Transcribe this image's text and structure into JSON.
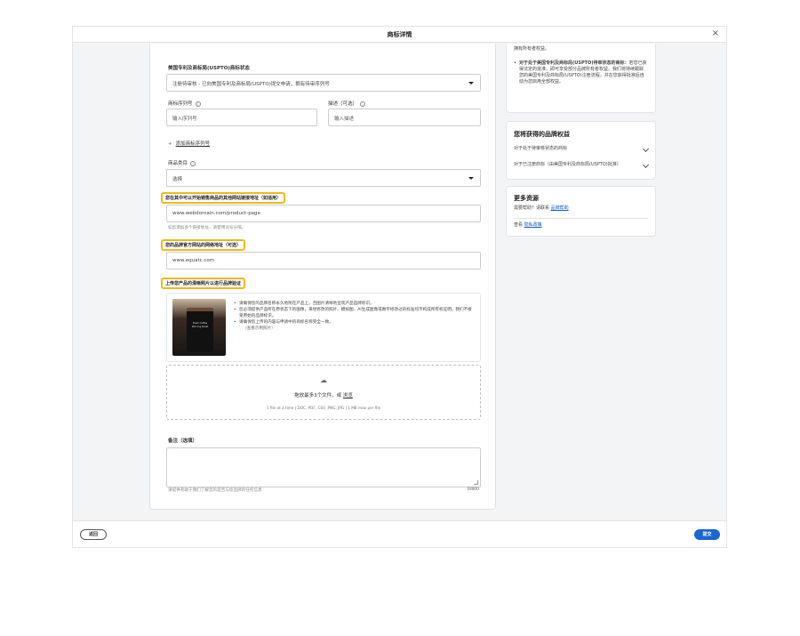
{
  "window": {
    "title": "商标详情",
    "close_glyph": "×"
  },
  "form": {
    "uspto_status_label": "美国专利及商标局(USPTO)商标状态",
    "uspto_status_value": "注册待审核 - 已向美国专利及商标局(USPTO)提交申请，拥有待审序列号",
    "serial_label": "商标序列号",
    "serial_placeholder": "输入序列号",
    "desc_label": "描述（可选）",
    "desc_placeholder": "输入描述",
    "add_serial_plus": "+",
    "add_serial_link": "添加商标序列号",
    "category_label": "商品类目",
    "category_value": "选择",
    "other_sites_label": "您在其中可以开始销售商品的其他网站链接地址（如适用）",
    "other_sites_value": "www.webdomain.com/product-page",
    "other_sites_hint": "如您添加多个链接地址，请使用逗号分隔。",
    "official_site_label": "您的品牌官方网站的网络地址（可选）",
    "official_site_value": "www.equatc.com",
    "upload_label": "上传您产品的清晰照片以进行品牌验证",
    "image_text": "Fresh Coffee Morning Roast",
    "guidelines": [
      "请确保您的品牌名称永久地附在产品上，且图片清晰地呈现产品品牌标识。",
      "您必须提供产品所在原状态下的图像，来经修改的照片、模拟图、AI生成图像或数字修改过的标准均不构成所有权证明。我们不接受原始的品牌标识。",
      "请确保您上传的内容与申请中的商标名称完全一致。"
    ],
    "guidelines_sub": "（查看示例照片）",
    "dropzone_icon": "upload-cloud",
    "dropzone_text": "拖放最多3个文件，或",
    "dropzone_link": "浏览",
    "dropzone_sub": "1 file at a time | DOC, PDF, CSV, PNG, JPG | 1 MB max per file",
    "notes_label": "备注（选填）",
    "notes_hint": "请提供有助于我们了解您的是否与您品牌的任何信息",
    "notes_counter": "0/800"
  },
  "sidebar": {
    "top_text": "拥有所有者权益。",
    "top_bullet_bold": "对于处于美国专利及商标局(USPTO)待审状态的商标：",
    "top_bullet_rest": "若您已获得法定的批准，即可享受部分品牌所有者权益。我们将持续跟踪您的美国专利及商标局(USPTO)注册流程，并在您获得批准后自动为您启用全部权益。",
    "benefits_title": "您将获得的品牌权益",
    "benefit_items": [
      "对于处于待审核状态的商标",
      "对于已注册商标（由美国专利及商标局(USPTO)批准）"
    ],
    "resources_title": "更多资源",
    "help_prefix": "需要帮助？请联系",
    "help_link": "品牌帮助",
    "privacy_prefix": "查看",
    "privacy_link": "隐私政策"
  },
  "footer": {
    "back_label": "返回",
    "submit_label": "提交"
  }
}
